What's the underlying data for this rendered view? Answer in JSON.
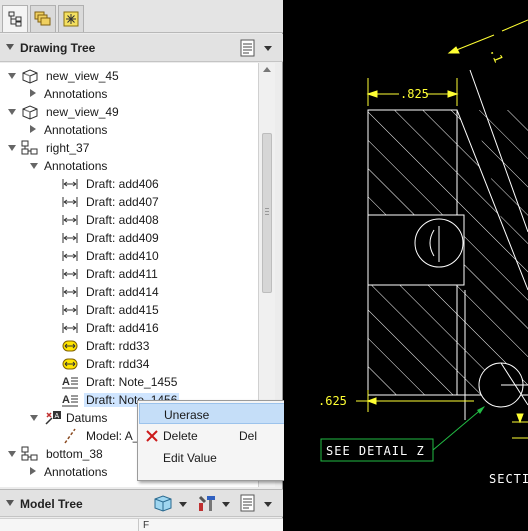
{
  "colors": {
    "drawing_yellow": "#ffff33",
    "drawing_white": "#ffffff",
    "detail_green": "#22bb44",
    "selection": "#cfe5ff",
    "menu_highlight": "#c5def8"
  },
  "tabs": [
    {
      "icon": "tree-structure-icon"
    },
    {
      "icon": "layers-icon"
    },
    {
      "icon": "star-burst-icon"
    }
  ],
  "drawing_tree": {
    "title": "Drawing Tree",
    "items": [
      {
        "label": "new_view_45",
        "expand": "down",
        "indent": 0,
        "icon": "view-3d-icon"
      },
      {
        "label": "Annotations",
        "expand": "right",
        "indent": 1,
        "icon": ""
      },
      {
        "label": "new_view_49",
        "expand": "down",
        "indent": 0,
        "icon": "view-3d-icon"
      },
      {
        "label": "Annotations",
        "expand": "right",
        "indent": 1,
        "icon": ""
      },
      {
        "label": "right_37",
        "expand": "down",
        "indent": 0,
        "icon": "view-projection-icon"
      },
      {
        "label": "Annotations",
        "expand": "down",
        "indent": 1,
        "icon": ""
      },
      {
        "label": "Draft: add406",
        "expand": "",
        "indent": 2,
        "icon": "dimension-icon"
      },
      {
        "label": "Draft: add407",
        "expand": "",
        "indent": 2,
        "icon": "dimension-icon"
      },
      {
        "label": "Draft: add408",
        "expand": "",
        "indent": 2,
        "icon": "dimension-icon"
      },
      {
        "label": "Draft: add409",
        "expand": "",
        "indent": 2,
        "icon": "dimension-icon"
      },
      {
        "label": "Draft: add410",
        "expand": "",
        "indent": 2,
        "icon": "dimension-icon"
      },
      {
        "label": "Draft: add411",
        "expand": "",
        "indent": 2,
        "icon": "dimension-icon"
      },
      {
        "label": "Draft: add414",
        "expand": "",
        "indent": 2,
        "icon": "dimension-icon"
      },
      {
        "label": "Draft: add415",
        "expand": "",
        "indent": 2,
        "icon": "dimension-icon"
      },
      {
        "label": "Draft: add416",
        "expand": "",
        "indent": 2,
        "icon": "dimension-icon"
      },
      {
        "label": "Draft: rdd33",
        "expand": "",
        "indent": 2,
        "icon": "reference-dimension-icon"
      },
      {
        "label": "Draft: rdd34",
        "expand": "",
        "indent": 2,
        "icon": "reference-dimension-icon"
      },
      {
        "label": "Draft: Note_1455",
        "expand": "",
        "indent": 2,
        "icon": "note-icon"
      },
      {
        "label": "Draft: Note_1456",
        "expand": "",
        "indent": 2,
        "icon": "note-icon",
        "selected": true
      },
      {
        "label": "Datums",
        "expand": "down",
        "indent": 1,
        "icon": "datum-icon"
      },
      {
        "label": "Model: A_",
        "expand": "",
        "indent": 2,
        "icon": "axis-icon"
      },
      {
        "label": "bottom_38",
        "expand": "down",
        "indent": 0,
        "icon": "view-projection-icon"
      },
      {
        "label": "Annotations",
        "expand": "right",
        "indent": 1,
        "icon": ""
      }
    ]
  },
  "model_tree": {
    "title": "Model Tree",
    "column_header": "F"
  },
  "context_menu": {
    "items": [
      {
        "label": "Unerase",
        "shortcut": "",
        "icon": "",
        "highlighted": true
      },
      {
        "label": "Delete",
        "shortcut": "Del",
        "icon": "delete-x-icon",
        "highlighted": false
      },
      {
        "label": "Edit Value",
        "shortcut": "",
        "icon": "",
        "highlighted": false
      }
    ]
  },
  "drawing": {
    "dim_top": ".825",
    "dim_left": ".625",
    "detail_callout": "SEE DETAIL  Z",
    "section_label": "SECTI"
  }
}
